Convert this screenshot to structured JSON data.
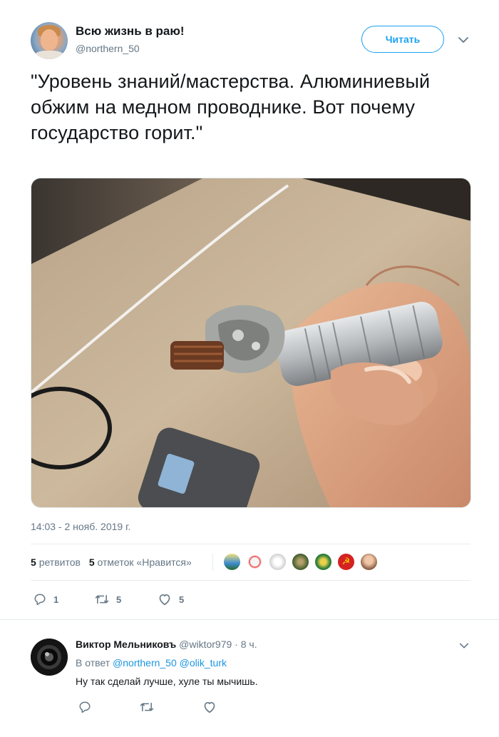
{
  "tweet": {
    "author": {
      "display_name": "Всю жизнь в раю!",
      "handle": "@northern_50"
    },
    "follow_label": "Читать",
    "text": "\"Уровень знаний/мастерства. Алюминиевый обжим на медном проводнике. Вот почему государство горит.\"",
    "timestamp": "14:03 - 2 нояб. 2019 г.",
    "stats": {
      "retweets_count": "5",
      "retweets_label": "ретвитов",
      "likes_count": "5",
      "likes_label": "отметок «Нравится»"
    },
    "actions": {
      "reply_count": "1",
      "retweet_count": "5",
      "like_count": "5"
    }
  },
  "reply": {
    "author_name": "Виктор Мельниковъ",
    "handle": "@wiktor979",
    "separator": "·",
    "time": "8 ч.",
    "in_reply_prefix": "В ответ",
    "mention_1": "@northern_50",
    "mention_2": "@olik_turk",
    "text": "Ну так сделай лучше, хуле ты мычишь."
  },
  "icons": {
    "caret": "chevron-down-icon",
    "reply": "reply-icon",
    "retweet": "retweet-icon",
    "like": "heart-icon"
  },
  "colors": {
    "accent": "#1da1f2",
    "link": "#1b95e0",
    "muted": "#657786",
    "text": "#14171a"
  }
}
